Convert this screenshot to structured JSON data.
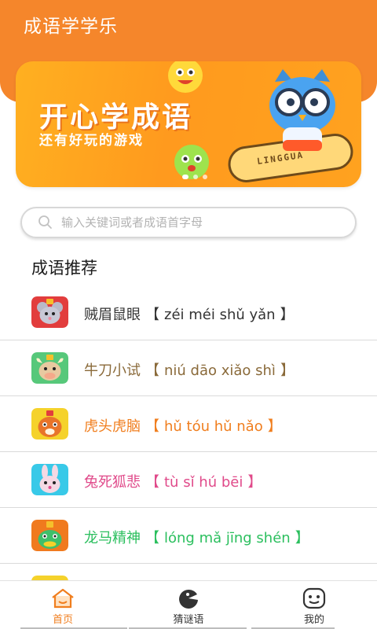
{
  "header": {
    "title": "成语学学乐"
  },
  "banner": {
    "headline": "开心学成语",
    "subline": "还有好玩的游戏",
    "board_label": "LINGGUA"
  },
  "search": {
    "placeholder": "输入关键词或者成语首字母",
    "value": ""
  },
  "section": {
    "title": "成语推荐"
  },
  "idioms": [
    {
      "text": "贼眉鼠眼",
      "pinyin": "zéi méi shǔ yǎn",
      "color": "#333333",
      "icon": "mouse-icon",
      "icon_bg": "#e23d3d"
    },
    {
      "text": "牛刀小试",
      "pinyin": "niú dāo xiǎo shì",
      "color": "#8a6a3a",
      "icon": "ox-icon",
      "icon_bg": "#57c87a"
    },
    {
      "text": "虎头虎脑",
      "pinyin": "hǔ tóu hǔ nǎo",
      "color": "#f07e1e",
      "icon": "tiger-icon",
      "icon_bg": "#f5d22b"
    },
    {
      "text": "兔死狐悲",
      "pinyin": "tù sǐ hú bēi",
      "color": "#e04a8a",
      "icon": "rabbit-icon",
      "icon_bg": "#38c9e8"
    },
    {
      "text": "龙马精神",
      "pinyin": "lóng mǎ jīng shén",
      "color": "#2bbf5e",
      "icon": "dragon-icon",
      "icon_bg": "#f07a1e"
    }
  ],
  "tabs": [
    {
      "label": "首页",
      "active": true,
      "icon": "home-icon"
    },
    {
      "label": "猜谜语",
      "active": false,
      "icon": "riddle-icon"
    },
    {
      "label": "我的",
      "active": false,
      "icon": "profile-icon"
    }
  ],
  "colors": {
    "accent": "#f5862b",
    "tab_active": "#f07e1e",
    "tab_inactive": "#333333"
  }
}
